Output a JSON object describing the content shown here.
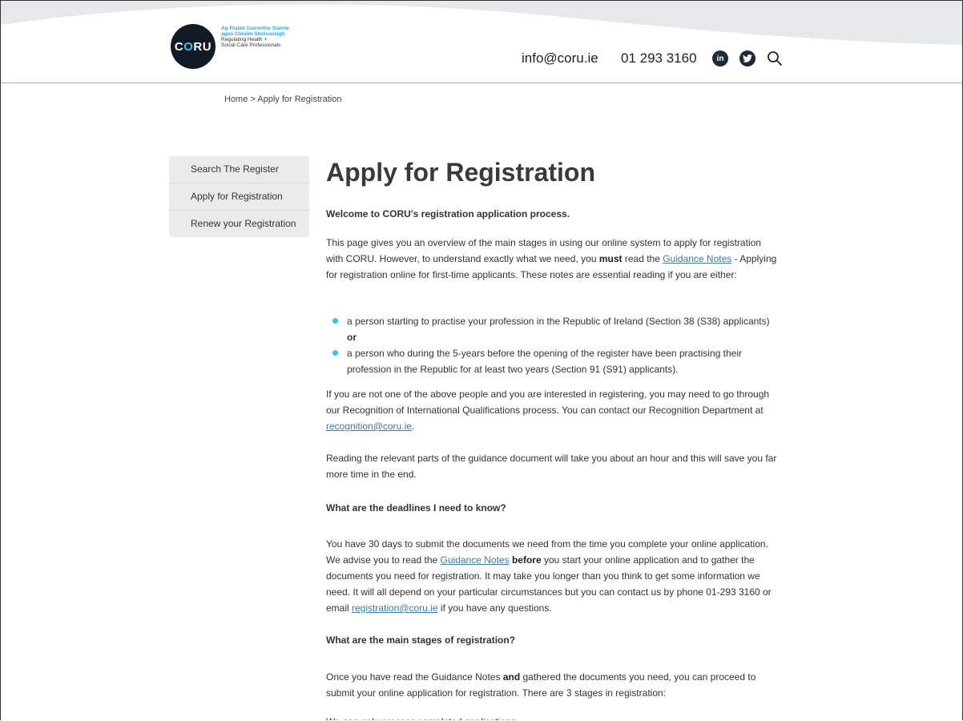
{
  "header": {
    "logo": {
      "name": "CORU",
      "line1": "Ag Rialáil Gairmithe Sláinte",
      "line2": "agus Cúraim Shóisialaigh",
      "line3": "Regulating Health +",
      "line4": "Social Care Professionals"
    },
    "email": "info@coru.ie",
    "phone": "01 293 3160",
    "social": {
      "linkedin": "in",
      "twitter": "t"
    }
  },
  "breadcrumb": "Home > Apply for Registration",
  "sidebar": {
    "items": [
      {
        "label": "Search The Register"
      },
      {
        "label": "Apply for Registration"
      },
      {
        "label": "Renew your Registration"
      }
    ]
  },
  "main": {
    "title": "Apply for Registration",
    "welcome": "Welcome to CORU's registration application process.",
    "intro": {
      "part1": "This page gives you an overview of the main stages in using our online system to apply for registration with CORU. However, to understand exactly what we need, you ",
      "must": "must",
      "part2": " read the ",
      "link": "Guidance Notes",
      "part3": " - Applying for registration online for first-time applicants. These notes are essential reading if you are either:"
    },
    "bullets": [
      {
        "text": "a person starting to practise your profession in the Republic of Ireland (Section 38 (S38) applicants) ",
        "bold": "or"
      },
      {
        "text": "a person who during the 5-years before the opening of the register have been practising their profession in the Republic for at least two years (Section 91 (S91) applicants).",
        "bold": ""
      }
    ],
    "ifnot": {
      "text": "If you are not one of the above people and you are interested in registering, you may need to go through our Recognition of International Qualifications process. You can contact our Recognition Department at ",
      "link": "recognition@coru.ie",
      "end": "."
    },
    "reading": "Reading the relevant parts of the guidance document will take you about an hour and this will save you far more time in the end.",
    "deadlines_heading": "What are the deadlines I need to know?",
    "deadlines": {
      "part1": "You have 30 days to submit the documents we need from the time you complete your online application. We advise you to read the ",
      "link": "Guidance Notes",
      "bold": "before",
      "part2": " you start your online application and to gather the documents you need for registration. It may take you longer than you think to get some information we need. It will all depend on your particular circumstances but you can contact us by phone 01-293 3160 or email ",
      "email": "registration@coru.ie",
      "part3": " if you have any questions."
    },
    "stages_heading": "What are the main stages of registration?",
    "once": {
      "part1": "Once you have read the Guidance Notes ",
      "bold": "and",
      "part2": " gathered the documents you need, you can proceed to submit your online application for registration. There are 3 stages in registration:"
    },
    "complete": "We can only process completed applications."
  },
  "colors": {
    "accent": "#3cc1e8",
    "link": "#3a7ca5",
    "logo_bg": "#121a26"
  }
}
